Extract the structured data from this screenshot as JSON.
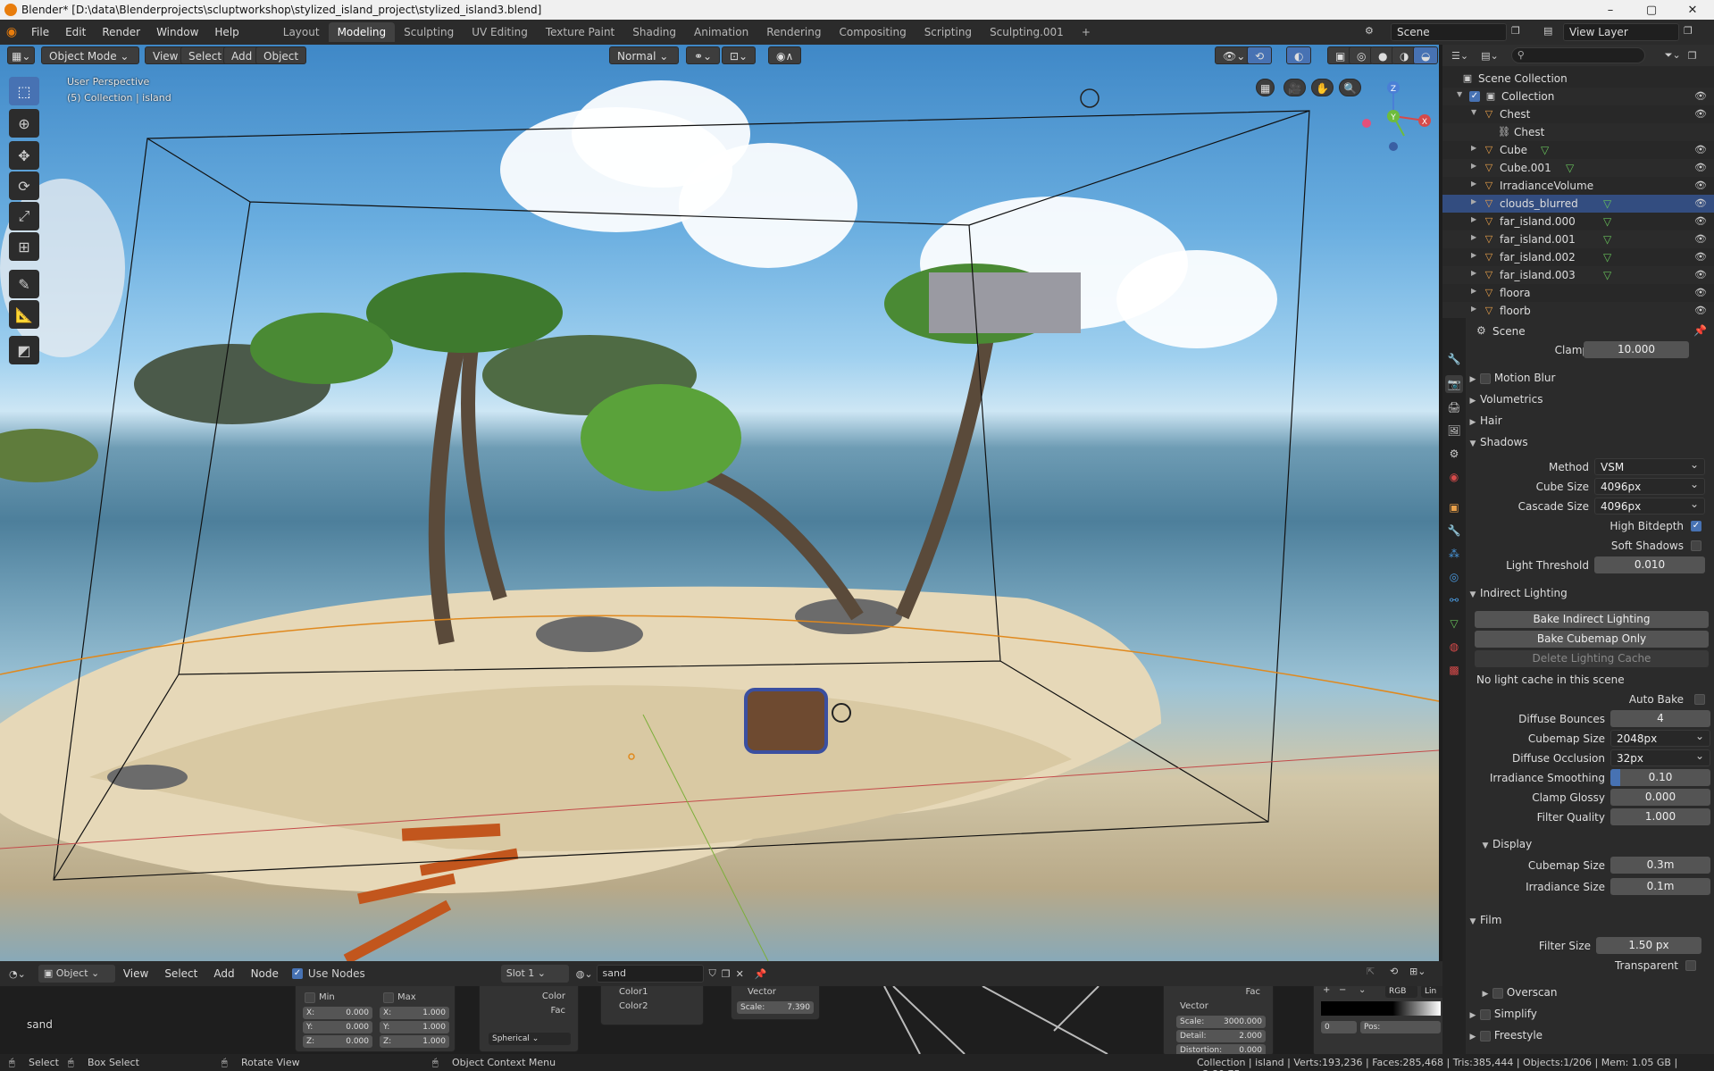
{
  "window": {
    "title": "Blender* [D:\\data\\Blenderprojects\\scluptworkshop\\stylized_island_project\\stylized_island3.blend]",
    "controls": [
      "–",
      "▢",
      "✕"
    ]
  },
  "menu": [
    "File",
    "Edit",
    "Render",
    "Window",
    "Help"
  ],
  "workspaces": [
    "Layout",
    "Modeling",
    "Sculpting",
    "UV Editing",
    "Texture Paint",
    "Shading",
    "Animation",
    "Rendering",
    "Compositing",
    "Scripting",
    "Sculpting.001"
  ],
  "active_workspace": "Modeling",
  "add_workspace": "+",
  "scene_field": "Scene",
  "view_layer_field": "View Layer",
  "viewport": {
    "mode": "Object Mode",
    "menus": [
      "View",
      "Select",
      "Add",
      "Object"
    ],
    "orientation": "Normal",
    "perspective_label": "User Perspective",
    "collection_label": "(5) Collection | island",
    "gizmo_axes": {
      "z": "Z",
      "y": "Y",
      "x": "X"
    }
  },
  "outliner": {
    "root": "Scene Collection",
    "rows": [
      {
        "label": "Collection",
        "kind": "collection",
        "indent": 0
      },
      {
        "label": "Chest",
        "kind": "object",
        "indent": 1
      },
      {
        "label": "Chest",
        "kind": "link",
        "indent": 2
      },
      {
        "label": "Cube",
        "kind": "object",
        "indent": 1,
        "mesh": true
      },
      {
        "label": "Cube.001",
        "kind": "object",
        "indent": 1,
        "mesh": true
      },
      {
        "label": "IrradianceVolume",
        "kind": "object",
        "indent": 1
      },
      {
        "label": "clouds_blurred",
        "kind": "object",
        "indent": 1,
        "mesh": true,
        "selected": true
      },
      {
        "label": "far_island.000",
        "kind": "object",
        "indent": 1,
        "mesh": true
      },
      {
        "label": "far_island.001",
        "kind": "object",
        "indent": 1,
        "mesh": true
      },
      {
        "label": "far_island.002",
        "kind": "object",
        "indent": 1,
        "mesh": true
      },
      {
        "label": "far_island.003",
        "kind": "object",
        "indent": 1,
        "mesh": true
      },
      {
        "label": "floora",
        "kind": "object",
        "indent": 1
      },
      {
        "label": "floorb",
        "kind": "object",
        "indent": 1
      }
    ]
  },
  "properties": {
    "context": "Scene",
    "clamp": {
      "label": "Clamp",
      "value": "10.000"
    },
    "sections_collapsed": [
      "Motion Blur",
      "Volumetrics",
      "Hair"
    ],
    "shadows": {
      "title": "Shadows",
      "method": {
        "label": "Method",
        "value": "VSM"
      },
      "cube_size": {
        "label": "Cube Size",
        "value": "4096px"
      },
      "cascade_size": {
        "label": "Cascade Size",
        "value": "4096px"
      },
      "high_bitdepth": {
        "label": "High Bitdepth",
        "checked": true
      },
      "soft_shadows": {
        "label": "Soft Shadows",
        "checked": false
      },
      "light_threshold": {
        "label": "Light Threshold",
        "value": "0.010"
      }
    },
    "indirect": {
      "title": "Indirect Lighting",
      "bake_indirect": "Bake Indirect Lighting",
      "bake_cubemap": "Bake Cubemap Only",
      "delete_cache": "Delete Lighting Cache",
      "cache_status": "No light cache in this scene",
      "auto_bake": {
        "label": "Auto Bake",
        "checked": false
      },
      "diffuse_bounces": {
        "label": "Diffuse Bounces",
        "value": "4"
      },
      "cubemap_size": {
        "label": "Cubemap Size",
        "value": "2048px"
      },
      "diffuse_occlusion": {
        "label": "Diffuse Occlusion",
        "value": "32px"
      },
      "irradiance_smoothing": {
        "label": "Irradiance Smoothing",
        "value": "0.10",
        "fill": 0.1
      },
      "clamp_glossy": {
        "label": "Clamp Glossy",
        "value": "0.000"
      },
      "filter_quality": {
        "label": "Filter Quality",
        "value": "1.000"
      }
    },
    "display": {
      "title": "Display",
      "cubemap_size": {
        "label": "Cubemap Size",
        "value": "0.3m"
      },
      "irradiance_size": {
        "label": "Irradiance Size",
        "value": "0.1m"
      }
    },
    "film": {
      "title": "Film",
      "filter_size": {
        "label": "Filter Size",
        "value": "1.50 px"
      },
      "transparent": {
        "label": "Transparent",
        "checked": false
      }
    },
    "overscan": "Overscan",
    "simplify": "Simplify",
    "freestyle": "Freestyle"
  },
  "node_editor": {
    "mode": "Object",
    "menus": [
      "View",
      "Select",
      "Add",
      "Node"
    ],
    "use_nodes": "Use Nodes",
    "slot": "Slot 1",
    "material": "sand",
    "frame_label": "sand",
    "mapping": {
      "min": "Min",
      "max": "Max",
      "x": "X:",
      "y": "Y:",
      "z": "Z:",
      "min_x": "0.000",
      "min_y": "0.000",
      "min_z": "0.000",
      "max_x": "1.000",
      "max_y": "1.000",
      "max_z": "1.000"
    },
    "texcoord": {
      "projection": "Spherical",
      "color": "Color",
      "fac": "Fac"
    },
    "mix": {
      "color1": "Color1",
      "color2": "Color2"
    },
    "voronoi": {
      "vector": "Vector",
      "scale_label": "Scale:",
      "scale": "7.390"
    },
    "noise": {
      "fac": "Fac",
      "vector": "Vector",
      "scale_label": "Scale:",
      "scale": "3000.000",
      "detail_label": "Detail:",
      "detail": "2.000",
      "distortion_label": "Distortion:",
      "distortion": "0.000"
    },
    "ramp": {
      "mode": "RGB",
      "interp": "Lin",
      "index": "0",
      "pos": "Pos:"
    }
  },
  "status": {
    "select": "Select",
    "box_select": "Box Select",
    "rotate_view": "Rotate View",
    "context_menu": "Object Context Menu",
    "stats": "Collection | island | Verts:193,236 | Faces:285,468 | Tris:385,444 | Objects:1/206 | Mem: 1.05 GB | v2.80.75"
  }
}
